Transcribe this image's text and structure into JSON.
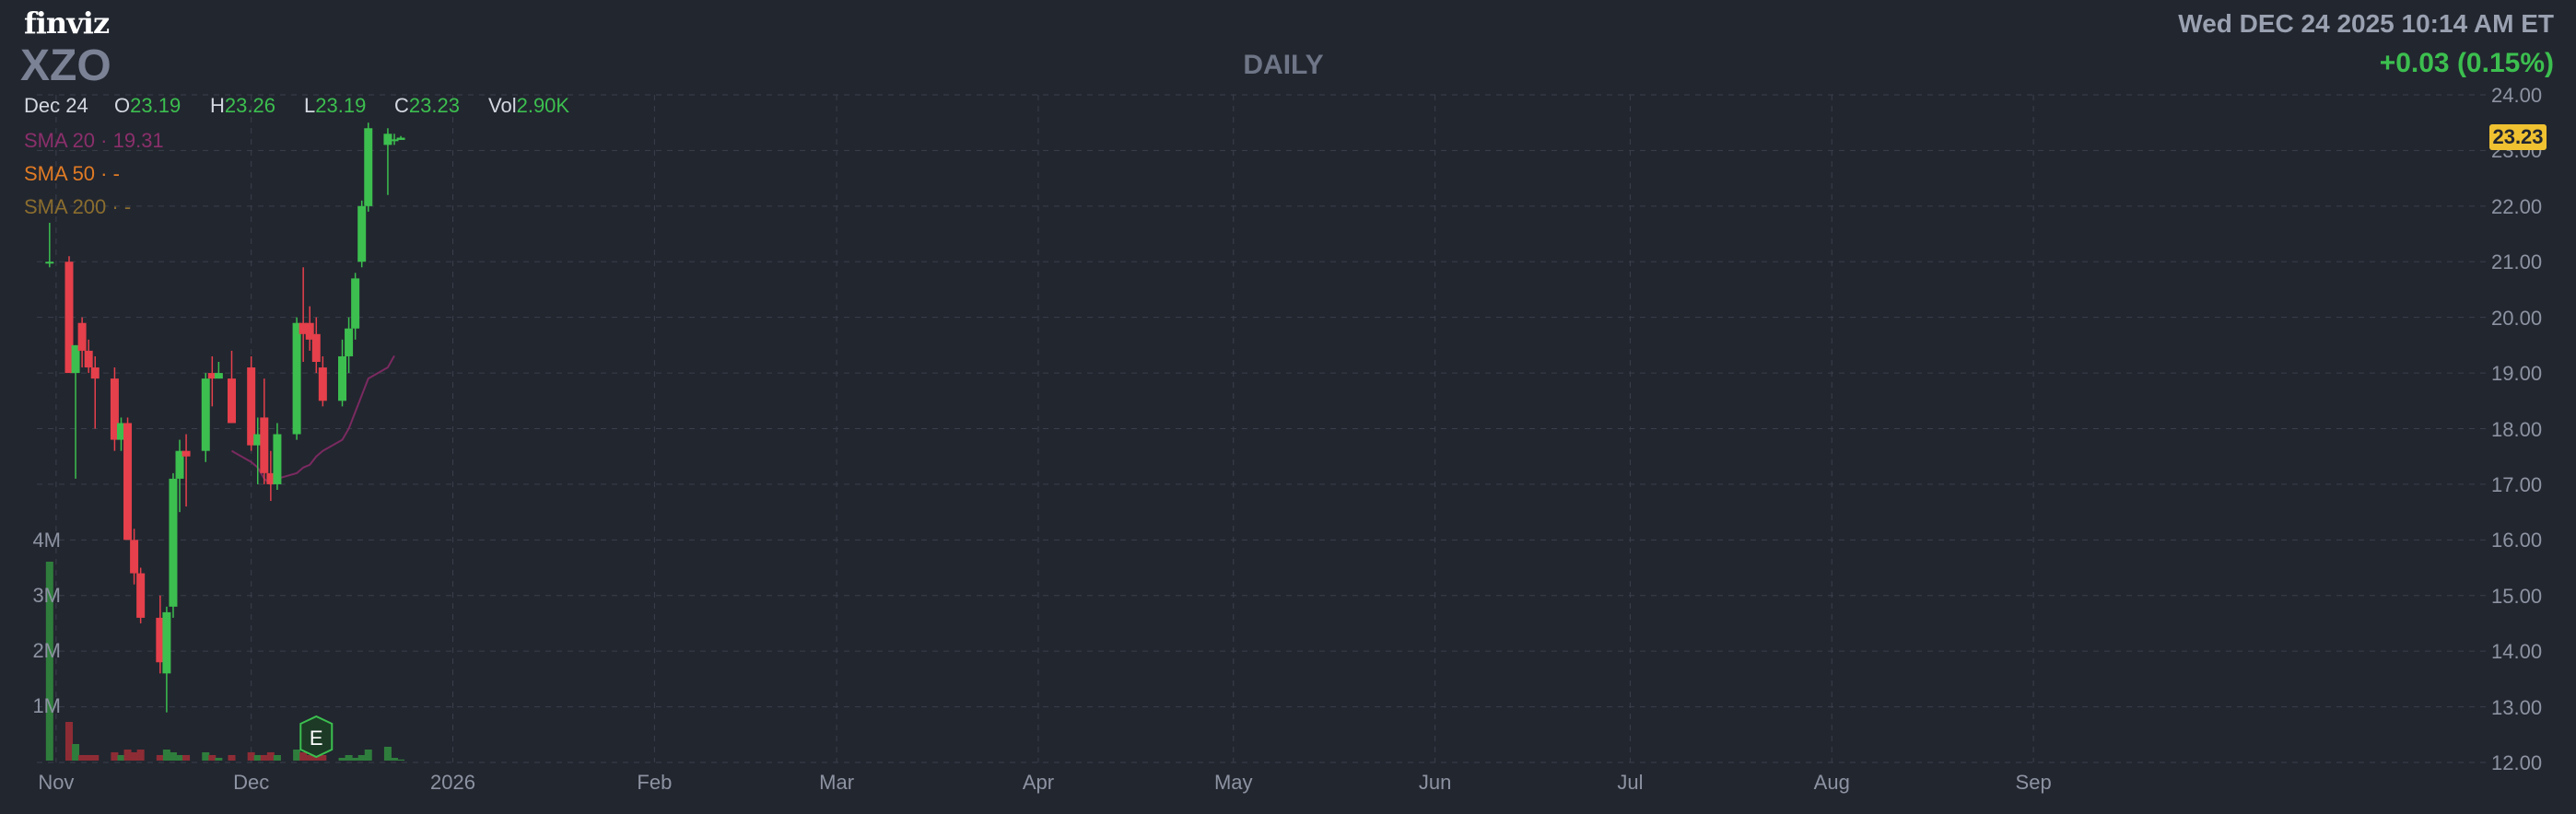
{
  "header": {
    "logo_text": "finviz",
    "ticker": "XZO",
    "timeframe": "DAILY",
    "datetime": "Wed DEC 24 2025 10:14 AM ET",
    "change": "+0.03 (0.15%)"
  },
  "ohlc": {
    "date": "Dec 24",
    "open_label": "O",
    "open": "23.19",
    "high_label": "H",
    "high": "23.26",
    "low_label": "L",
    "low": "23.19",
    "close_label": "C",
    "close": "23.23",
    "vol_label": "Vol",
    "vol": "2.90K"
  },
  "indicators": [
    {
      "label": "SMA 20",
      "value": "19.31",
      "color": "#8b2f6b"
    },
    {
      "label": "SMA 50",
      "value": "-",
      "color": "#e07b24"
    },
    {
      "label": "SMA 200",
      "value": "-",
      "color": "#8a6d2e"
    }
  ],
  "current_price_tag": "23.23",
  "colors": {
    "up": "#3cbf4f",
    "down": "#e5404b",
    "background": "#22262f",
    "grid": "#3a3f4b",
    "sma20": "#7a2a60",
    "price_tag": "#f0c231"
  },
  "chart_data": {
    "type": "candlestick",
    "title": "",
    "ylim": [
      12,
      24
    ],
    "y_ticks": [
      "24.00",
      "23.00",
      "22.00",
      "21.00",
      "20.00",
      "19.00",
      "18.00",
      "17.00",
      "16.00",
      "15.00",
      "14.00",
      "13.00",
      "12.00"
    ],
    "x_ticks": [
      "Nov",
      "Dec",
      "2026",
      "Feb",
      "Mar",
      "Apr",
      "May",
      "Jun",
      "Jul",
      "Aug",
      "Sep"
    ],
    "volume_ticks": [
      "4M",
      "3M",
      "2M",
      "1M"
    ],
    "earnings_marker": {
      "label": "E",
      "date": "Dec 11"
    },
    "candles": [
      {
        "d": "Oct 31",
        "o": 21.0,
        "h": 21.7,
        "l": 20.9,
        "c": 21.0
      },
      {
        "d": "Nov 3",
        "o": 21.0,
        "h": 21.1,
        "l": 19.1,
        "c": 19.0
      },
      {
        "d": "Nov 4",
        "o": 19.0,
        "h": 19.5,
        "l": 17.1,
        "c": 19.5
      },
      {
        "d": "Nov 5",
        "o": 19.9,
        "h": 20.0,
        "l": 19.1,
        "c": 19.4
      },
      {
        "d": "Nov 6",
        "o": 19.4,
        "h": 19.6,
        "l": 19.0,
        "c": 19.1
      },
      {
        "d": "Nov 7",
        "o": 19.1,
        "h": 19.3,
        "l": 18.0,
        "c": 18.9
      },
      {
        "d": "Nov 10",
        "o": 18.9,
        "h": 19.1,
        "l": 17.6,
        "c": 17.8
      },
      {
        "d": "Nov 11",
        "o": 17.8,
        "h": 18.2,
        "l": 17.6,
        "c": 18.1
      },
      {
        "d": "Nov 12",
        "o": 18.1,
        "h": 18.2,
        "l": 16.2,
        "c": 16.0
      },
      {
        "d": "Nov 13",
        "o": 16.0,
        "h": 16.2,
        "l": 15.2,
        "c": 15.4
      },
      {
        "d": "Nov 14",
        "o": 15.4,
        "h": 15.5,
        "l": 14.5,
        "c": 14.6
      },
      {
        "d": "Nov 17",
        "o": 14.6,
        "h": 15.0,
        "l": 13.6,
        "c": 13.8
      },
      {
        "d": "Nov 18",
        "o": 13.6,
        "h": 14.8,
        "l": 12.9,
        "c": 14.7
      },
      {
        "d": "Nov 19",
        "o": 14.8,
        "h": 17.2,
        "l": 14.6,
        "c": 17.1
      },
      {
        "d": "Nov 20",
        "o": 17.1,
        "h": 17.8,
        "l": 16.5,
        "c": 17.6
      },
      {
        "d": "Nov 21",
        "o": 17.6,
        "h": 17.9,
        "l": 16.6,
        "c": 17.5
      },
      {
        "d": "Nov 24",
        "o": 17.6,
        "h": 19.0,
        "l": 17.4,
        "c": 18.9
      },
      {
        "d": "Nov 25",
        "o": 19.0,
        "h": 19.3,
        "l": 18.4,
        "c": 18.9
      },
      {
        "d": "Nov 26",
        "o": 18.9,
        "h": 19.2,
        "l": 18.9,
        "c": 19.0
      },
      {
        "d": "Nov 28",
        "o": 18.9,
        "h": 19.4,
        "l": 18.1,
        "c": 18.1
      },
      {
        "d": "Dec 1",
        "o": 19.1,
        "h": 19.3,
        "l": 17.6,
        "c": 17.7
      },
      {
        "d": "Dec 2",
        "o": 17.7,
        "h": 18.2,
        "l": 17.0,
        "c": 17.9
      },
      {
        "d": "Dec 3",
        "o": 18.2,
        "h": 18.9,
        "l": 17.0,
        "c": 17.2
      },
      {
        "d": "Dec 4",
        "o": 17.2,
        "h": 17.6,
        "l": 16.7,
        "c": 17.0
      },
      {
        "d": "Dec 5",
        "o": 17.0,
        "h": 18.1,
        "l": 16.9,
        "c": 17.9
      },
      {
        "d": "Dec 8",
        "o": 17.9,
        "h": 20.0,
        "l": 17.8,
        "c": 19.9
      },
      {
        "d": "Dec 9",
        "o": 19.9,
        "h": 20.9,
        "l": 19.2,
        "c": 19.7
      },
      {
        "d": "Dec 10",
        "o": 19.9,
        "h": 20.2,
        "l": 19.4,
        "c": 19.6
      },
      {
        "d": "Dec 11",
        "o": 19.7,
        "h": 20.0,
        "l": 19.0,
        "c": 19.2
      },
      {
        "d": "Dec 12",
        "o": 19.1,
        "h": 19.3,
        "l": 18.4,
        "c": 18.5
      },
      {
        "d": "Dec 15",
        "o": 18.5,
        "h": 19.6,
        "l": 18.4,
        "c": 19.3
      },
      {
        "d": "Dec 16",
        "o": 19.3,
        "h": 20.0,
        "l": 19.0,
        "c": 19.8
      },
      {
        "d": "Dec 17",
        "o": 19.8,
        "h": 20.8,
        "l": 19.6,
        "c": 20.7
      },
      {
        "d": "Dec 18",
        "o": 21.0,
        "h": 22.1,
        "l": 20.9,
        "c": 22.0
      },
      {
        "d": "Dec 19",
        "o": 22.0,
        "h": 23.5,
        "l": 21.9,
        "c": 23.4
      },
      {
        "d": "Dec 22",
        "o": 23.1,
        "h": 23.4,
        "l": 22.2,
        "c": 23.3
      },
      {
        "d": "Dec 23",
        "o": 23.2,
        "h": 23.3,
        "l": 23.1,
        "c": 23.2
      },
      {
        "d": "Dec 24",
        "o": 23.19,
        "h": 23.26,
        "l": 23.19,
        "c": 23.23
      }
    ],
    "volume_m": [
      3.6,
      0.7,
      0.3,
      0.1,
      0.1,
      0.1,
      0.15,
      0.1,
      0.2,
      0.15,
      0.2,
      0.1,
      0.2,
      0.15,
      0.1,
      0.1,
      0.15,
      0.1,
      0.05,
      0.1,
      0.15,
      0.1,
      0.1,
      0.15,
      0.1,
      0.2,
      0.15,
      0.1,
      0.15,
      0.1,
      0.05,
      0.1,
      0.05,
      0.1,
      0.2,
      0.25,
      0.05,
      0.02
    ],
    "sma20": [
      {
        "d": "Nov 28",
        "v": 17.6
      },
      {
        "d": "Dec 1",
        "v": 17.4
      },
      {
        "d": "Dec 2",
        "v": 17.3
      },
      {
        "d": "Dec 3",
        "v": 17.1
      },
      {
        "d": "Dec 4",
        "v": 17.0
      },
      {
        "d": "Dec 5",
        "v": 17.1
      },
      {
        "d": "Dec 8",
        "v": 17.2
      },
      {
        "d": "Dec 9",
        "v": 17.3
      },
      {
        "d": "Dec 10",
        "v": 17.35
      },
      {
        "d": "Dec 11",
        "v": 17.5
      },
      {
        "d": "Dec 12",
        "v": 17.6
      },
      {
        "d": "Dec 15",
        "v": 17.8
      },
      {
        "d": "Dec 16",
        "v": 18.0
      },
      {
        "d": "Dec 17",
        "v": 18.3
      },
      {
        "d": "Dec 18",
        "v": 18.6
      },
      {
        "d": "Dec 19",
        "v": 18.9
      },
      {
        "d": "Dec 22",
        "v": 19.1
      },
      {
        "d": "Dec 23",
        "v": 19.31
      }
    ]
  }
}
